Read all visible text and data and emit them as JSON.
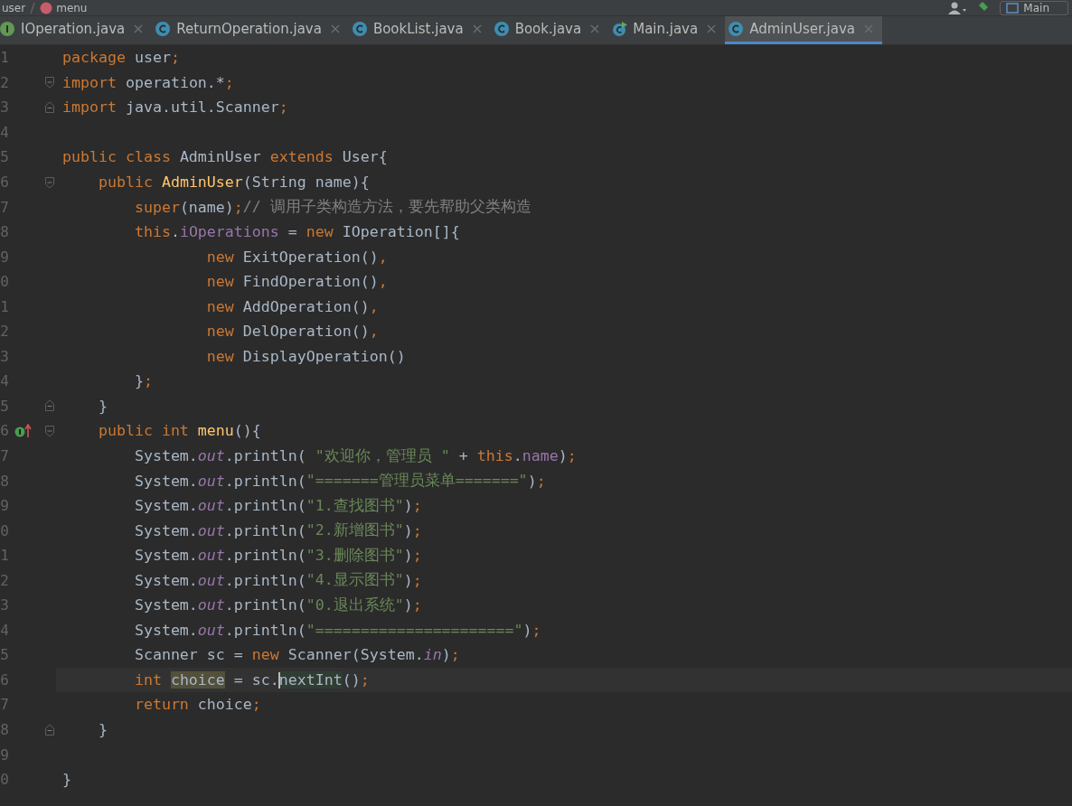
{
  "breadcrumbs": [
    {
      "text": "user"
    },
    {
      "text": "menu"
    }
  ],
  "run_config": {
    "label": "Main"
  },
  "tabs": [
    {
      "label": "IOperation.java",
      "kind": "interface",
      "selected": false
    },
    {
      "label": "ReturnOperation.java",
      "kind": "class",
      "selected": false
    },
    {
      "label": "BookList.java",
      "kind": "class",
      "selected": false
    },
    {
      "label": "Book.java",
      "kind": "class",
      "selected": false
    },
    {
      "label": "Main.java",
      "kind": "runnable",
      "selected": false
    },
    {
      "label": "AdminUser.java",
      "kind": "class",
      "selected": true
    }
  ],
  "lines": [
    {
      "number": "1",
      "tokens": [
        {
          "kind": "kw",
          "text": "package"
        },
        {
          "kind": "plain",
          "text": " user"
        },
        {
          "kind": "punct",
          "text": ";"
        }
      ]
    },
    {
      "number": "2",
      "fold_start": true,
      "tokens": [
        {
          "kind": "kw",
          "text": "import"
        },
        {
          "kind": "plain",
          "text": " operation.*"
        },
        {
          "kind": "punct",
          "text": ";"
        }
      ]
    },
    {
      "number": "3",
      "fold_end": true,
      "tokens": [
        {
          "kind": "kw",
          "text": "import"
        },
        {
          "kind": "plain",
          "text": " java.util.Scanner"
        },
        {
          "kind": "punct",
          "text": ";"
        }
      ]
    },
    {
      "number": "4"
    },
    {
      "number": "5",
      "tokens": [
        {
          "kind": "kw",
          "text": "public class"
        },
        {
          "kind": "plain",
          "text": " AdminUser "
        },
        {
          "kind": "kw",
          "text": "extends"
        },
        {
          "kind": "plain",
          "text": " User{"
        }
      ]
    },
    {
      "number": "6",
      "fold_start": true,
      "tokens": [
        {
          "kind": "kw",
          "text": "    public "
        },
        {
          "kind": "decl",
          "text": "AdminUser"
        },
        {
          "kind": "plain",
          "text": "(String name){"
        }
      ]
    },
    {
      "number": "7",
      "tokens": [
        {
          "kind": "kw",
          "text": "        super"
        },
        {
          "kind": "plain",
          "text": "(name)"
        },
        {
          "kind": "punct",
          "text": ";"
        },
        {
          "kind": "comment",
          "text": "// 调用子类构造方法，要先帮助父类构造"
        }
      ]
    },
    {
      "number": "8",
      "tokens": [
        {
          "kind": "kw",
          "text": "        this"
        },
        {
          "kind": "plain",
          "text": "."
        },
        {
          "kind": "field",
          "text": "iOperations"
        },
        {
          "kind": "plain",
          "text": " = "
        },
        {
          "kind": "kw",
          "text": "new"
        },
        {
          "kind": "plain",
          "text": " IOperation[]{"
        }
      ]
    },
    {
      "number": "9",
      "tokens": [
        {
          "kind": "kw",
          "text": "                new"
        },
        {
          "kind": "plain",
          "text": " ExitOperation()"
        },
        {
          "kind": "punct",
          "text": ","
        }
      ]
    },
    {
      "number": "0",
      "tokens": [
        {
          "kind": "kw",
          "text": "                new"
        },
        {
          "kind": "plain",
          "text": " FindOperation()"
        },
        {
          "kind": "punct",
          "text": ","
        }
      ]
    },
    {
      "number": "1",
      "tokens": [
        {
          "kind": "kw",
          "text": "                new"
        },
        {
          "kind": "plain",
          "text": " AddOperation()"
        },
        {
          "kind": "punct",
          "text": ","
        }
      ]
    },
    {
      "number": "2",
      "tokens": [
        {
          "kind": "kw",
          "text": "                new"
        },
        {
          "kind": "plain",
          "text": " DelOperation()"
        },
        {
          "kind": "punct",
          "text": ","
        }
      ]
    },
    {
      "number": "3",
      "tokens": [
        {
          "kind": "kw",
          "text": "                new"
        },
        {
          "kind": "plain",
          "text": " DisplayOperation()"
        }
      ]
    },
    {
      "number": "4",
      "tokens": [
        {
          "kind": "plain",
          "text": "        }"
        },
        {
          "kind": "punct",
          "text": ";"
        }
      ]
    },
    {
      "number": "5",
      "fold_end": true,
      "tokens": [
        {
          "kind": "plain",
          "text": "    }"
        }
      ]
    },
    {
      "number": "6",
      "fold_start": true,
      "implements": true,
      "tokens": [
        {
          "kind": "kw",
          "text": "    public int "
        },
        {
          "kind": "decl",
          "text": "menu"
        },
        {
          "kind": "plain",
          "text": "(){"
        }
      ]
    },
    {
      "number": "7",
      "tokens": [
        {
          "kind": "plain",
          "text": "        System."
        },
        {
          "kind": "static",
          "text": "out"
        },
        {
          "kind": "plain",
          "text": ".println( "
        },
        {
          "kind": "str",
          "text": "\"欢迎你，管理员 \""
        },
        {
          "kind": "plain",
          "text": " + "
        },
        {
          "kind": "kw",
          "text": "this"
        },
        {
          "kind": "plain",
          "text": "."
        },
        {
          "kind": "field",
          "text": "name"
        },
        {
          "kind": "plain",
          "text": ")"
        },
        {
          "kind": "punct",
          "text": ";"
        }
      ]
    },
    {
      "number": "8",
      "tokens": [
        {
          "kind": "plain",
          "text": "        System."
        },
        {
          "kind": "static",
          "text": "out"
        },
        {
          "kind": "plain",
          "text": ".println("
        },
        {
          "kind": "str",
          "text": "\"=======管理员菜单=======\""
        },
        {
          "kind": "plain",
          "text": ")"
        },
        {
          "kind": "punct",
          "text": ";"
        }
      ]
    },
    {
      "number": "9",
      "tokens": [
        {
          "kind": "plain",
          "text": "        System."
        },
        {
          "kind": "static",
          "text": "out"
        },
        {
          "kind": "plain",
          "text": ".println("
        },
        {
          "kind": "str",
          "text": "\"1.查找图书\""
        },
        {
          "kind": "plain",
          "text": ")"
        },
        {
          "kind": "punct",
          "text": ";"
        }
      ]
    },
    {
      "number": "0",
      "tokens": [
        {
          "kind": "plain",
          "text": "        System."
        },
        {
          "kind": "static",
          "text": "out"
        },
        {
          "kind": "plain",
          "text": ".println("
        },
        {
          "kind": "str",
          "text": "\"2.新增图书\""
        },
        {
          "kind": "plain",
          "text": ")"
        },
        {
          "kind": "punct",
          "text": ";"
        }
      ]
    },
    {
      "number": "1",
      "tokens": [
        {
          "kind": "plain",
          "text": "        System."
        },
        {
          "kind": "static",
          "text": "out"
        },
        {
          "kind": "plain",
          "text": ".println("
        },
        {
          "kind": "str",
          "text": "\"3.删除图书\""
        },
        {
          "kind": "plain",
          "text": ")"
        },
        {
          "kind": "punct",
          "text": ";"
        }
      ]
    },
    {
      "number": "2",
      "tokens": [
        {
          "kind": "plain",
          "text": "        System."
        },
        {
          "kind": "static",
          "text": "out"
        },
        {
          "kind": "plain",
          "text": ".println("
        },
        {
          "kind": "str",
          "text": "\"4.显示图书\""
        },
        {
          "kind": "plain",
          "text": ")"
        },
        {
          "kind": "punct",
          "text": ";"
        }
      ]
    },
    {
      "number": "3",
      "tokens": [
        {
          "kind": "plain",
          "text": "        System."
        },
        {
          "kind": "static",
          "text": "out"
        },
        {
          "kind": "plain",
          "text": ".println("
        },
        {
          "kind": "str",
          "text": "\"0.退出系统\""
        },
        {
          "kind": "plain",
          "text": ")"
        },
        {
          "kind": "punct",
          "text": ";"
        }
      ]
    },
    {
      "number": "4",
      "tokens": [
        {
          "kind": "plain",
          "text": "        System."
        },
        {
          "kind": "static",
          "text": "out"
        },
        {
          "kind": "plain",
          "text": ".println("
        },
        {
          "kind": "str",
          "text": "\"======================\""
        },
        {
          "kind": "plain",
          "text": ")"
        },
        {
          "kind": "punct",
          "text": ";"
        }
      ]
    },
    {
      "number": "5",
      "tokens": [
        {
          "kind": "plain",
          "text": "        Scanner sc = "
        },
        {
          "kind": "kw",
          "text": "new"
        },
        {
          "kind": "plain",
          "text": " Scanner(System."
        },
        {
          "kind": "static",
          "text": "in"
        },
        {
          "kind": "plain",
          "text": ")"
        },
        {
          "kind": "punct",
          "text": ";"
        }
      ]
    },
    {
      "number": "6",
      "current": true,
      "tokens": [
        {
          "kind": "kw",
          "text": "        int "
        },
        {
          "kind": "usage",
          "text": "choice"
        },
        {
          "kind": "plain",
          "text": " = sc."
        },
        {
          "kind": "match",
          "text": "nextInt",
          "caret": true
        },
        {
          "kind": "plain",
          "text": "()"
        },
        {
          "kind": "punct",
          "text": ";"
        }
      ]
    },
    {
      "number": "7",
      "tokens": [
        {
          "kind": "kw",
          "text": "        return"
        },
        {
          "kind": "plain",
          "text": " choice"
        },
        {
          "kind": "punct",
          "text": ";"
        }
      ]
    },
    {
      "number": "8",
      "fold_end": true,
      "tokens": [
        {
          "kind": "plain",
          "text": "    }"
        }
      ]
    },
    {
      "number": "9"
    },
    {
      "number": "0",
      "tokens": [
        {
          "kind": "plain",
          "text": "}"
        }
      ]
    }
  ]
}
